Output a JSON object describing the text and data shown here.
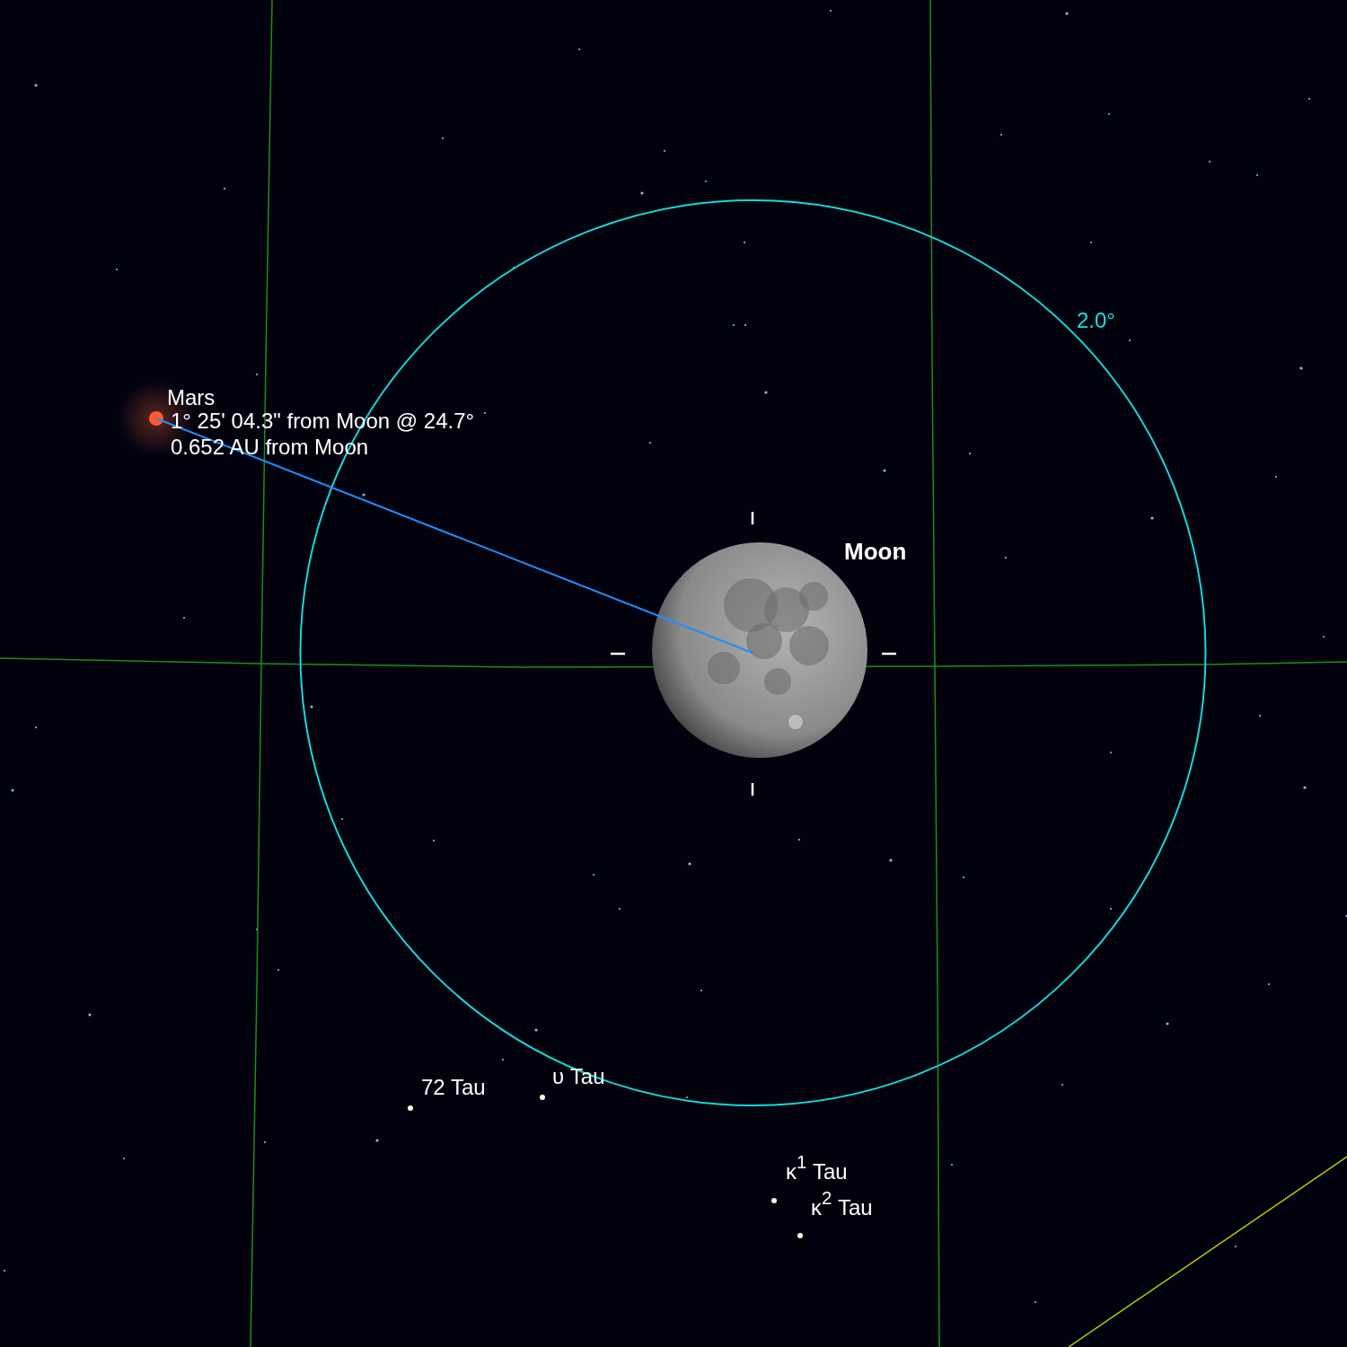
{
  "chart": {
    "objects": [
      {
        "kind": "planet",
        "label": "Mars",
        "details": [
          "1° 25' 04.3\" from Moon @ 24.7°",
          "0.652 AU from Moon"
        ]
      },
      {
        "kind": "moon",
        "label": "Moon"
      },
      {
        "kind": "star",
        "label": "72 Tau"
      },
      {
        "kind": "star",
        "label": "υ Tau"
      },
      {
        "kind": "star",
        "label": "κ$^{1}$ Tau"
      },
      {
        "kind": "star",
        "label": "κ$^{2}$ Tau"
      }
    ],
    "field_circle": {
      "label": "2.0°"
    }
  }
}
